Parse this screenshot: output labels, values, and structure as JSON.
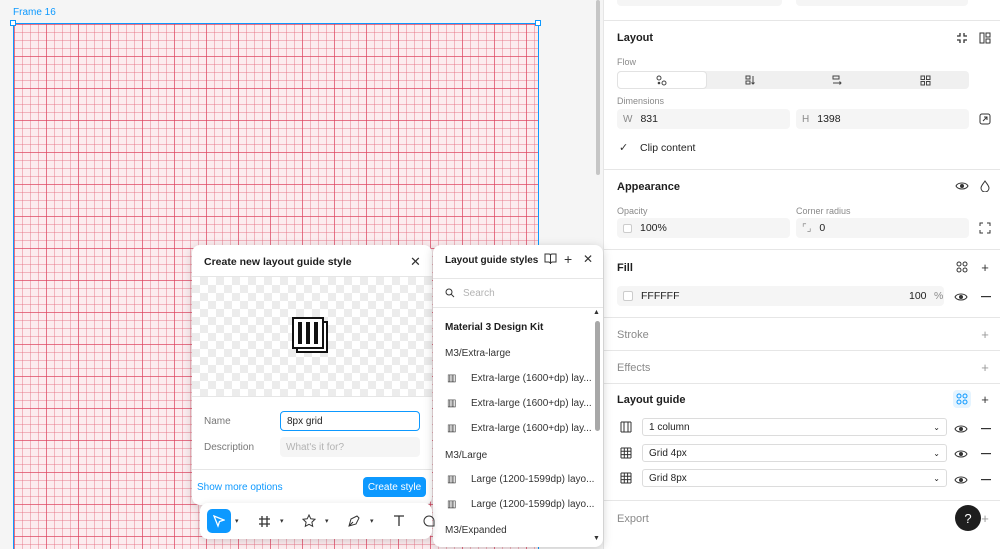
{
  "canvas": {
    "frame_label": "Frame 16"
  },
  "layout": {
    "title": "Layout",
    "flow_label": "Flow",
    "dimensions_label": "Dimensions",
    "width_prefix": "W",
    "width_value": "831",
    "height_prefix": "H",
    "height_value": "1398",
    "clip_content": "Clip content"
  },
  "appearance": {
    "title": "Appearance",
    "opacity_label": "Opacity",
    "opacity_value": "100%",
    "radius_label": "Corner radius",
    "radius_value": "0"
  },
  "fill": {
    "title": "Fill",
    "hex": "FFFFFF",
    "opacity": "100",
    "unit": "%"
  },
  "stroke": {
    "title": "Stroke"
  },
  "effects": {
    "title": "Effects"
  },
  "layout_guide": {
    "title": "Layout guide",
    "guides": [
      {
        "label": "1 column",
        "icon": "columns-icon"
      },
      {
        "label": "Grid 4px",
        "icon": "grid-icon"
      },
      {
        "label": "Grid 8px",
        "icon": "grid-icon"
      }
    ]
  },
  "export": {
    "title": "Export"
  },
  "help": {
    "label": "?"
  },
  "create_dialog": {
    "title": "Create new layout guide style",
    "name_label": "Name",
    "name_value": "8px grid",
    "description_label": "Description",
    "description_placeholder": "What's it for?",
    "more_options": "Show more options",
    "create_button": "Create style"
  },
  "styles_panel": {
    "title": "Layout guide styles",
    "search_placeholder": "Search",
    "rows": [
      {
        "kind": "head",
        "label": "Material 3 Design Kit"
      },
      {
        "kind": "group",
        "label": "M3/Extra-large"
      },
      {
        "kind": "item",
        "label": "Extra-large (1600+dp) lay..."
      },
      {
        "kind": "item",
        "label": "Extra-large (1600+dp) lay..."
      },
      {
        "kind": "item",
        "label": "Extra-large (1600+dp) lay..."
      },
      {
        "kind": "group",
        "label": "M3/Large"
      },
      {
        "kind": "item",
        "label": "Large (1200-1599dp) layo..."
      },
      {
        "kind": "item",
        "label": "Large (1200-1599dp) layo..."
      },
      {
        "kind": "group",
        "label": "M3/Expanded"
      }
    ]
  },
  "colors": {
    "accent": "#0d99ff",
    "grid_line": "#dc3c5a"
  }
}
